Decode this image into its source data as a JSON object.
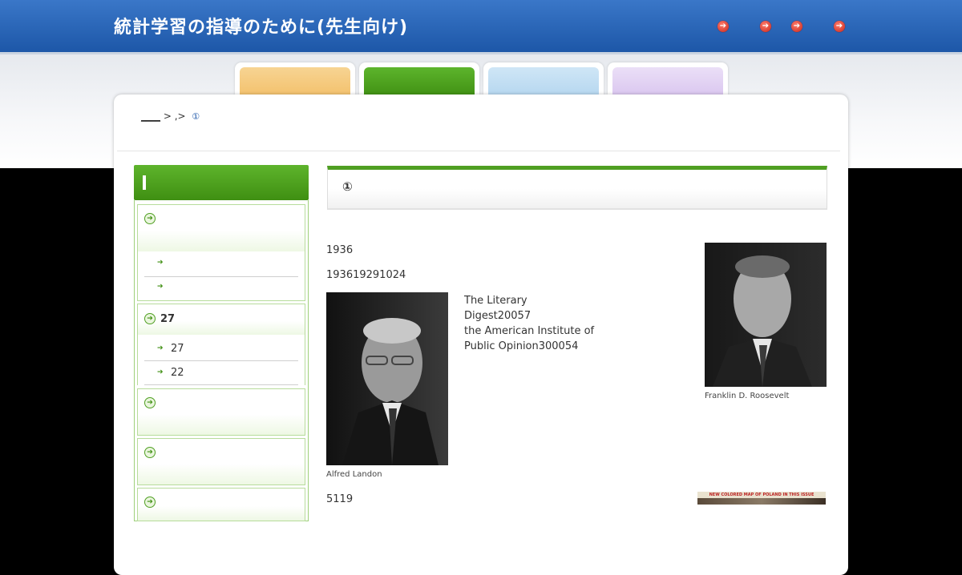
{
  "header": {
    "title": "統計学習の指導のために(先生向け)",
    "links": [
      "",
      "",
      "",
      ""
    ]
  },
  "tabs": [
    {
      "name": "tab-1",
      "color": "#f2c477"
    },
    {
      "name": "tab-2",
      "color": "#4a9d1e"
    },
    {
      "name": "tab-3",
      "color": "#bcd9ef"
    },
    {
      "name": "tab-4",
      "color": "#dcc8ef"
    }
  ],
  "breadcrumb": {
    "home": "____",
    "sep1": ">",
    "middle": ",",
    "sep2": ">",
    "current": "①"
  },
  "sidebar": {
    "groups": [
      {
        "title": "",
        "items": [
          "",
          ""
        ]
      },
      {
        "title": "27",
        "items": [
          "27",
          "22"
        ]
      },
      {
        "title": "",
        "items": []
      },
      {
        "title": "",
        "items": []
      },
      {
        "title": "",
        "items": []
      }
    ]
  },
  "main": {
    "heading": "①",
    "p1": "1936",
    "p2": "193619291024",
    "description": [
      "The Literary",
      "Digest20057",
      "the American Institute of",
      "Public Opinion300054"
    ],
    "caption_left": "Alfred Landon",
    "caption_right": "Franklin D. Roosevelt",
    "p3": "5119",
    "magazine_banner": "NEW COLORED MAP OF POLAND IN THIS ISSUE"
  },
  "colors": {
    "header_blue": "#2a66b8",
    "accent_green": "#4a9d1e",
    "link_red": "#d33a2c"
  }
}
